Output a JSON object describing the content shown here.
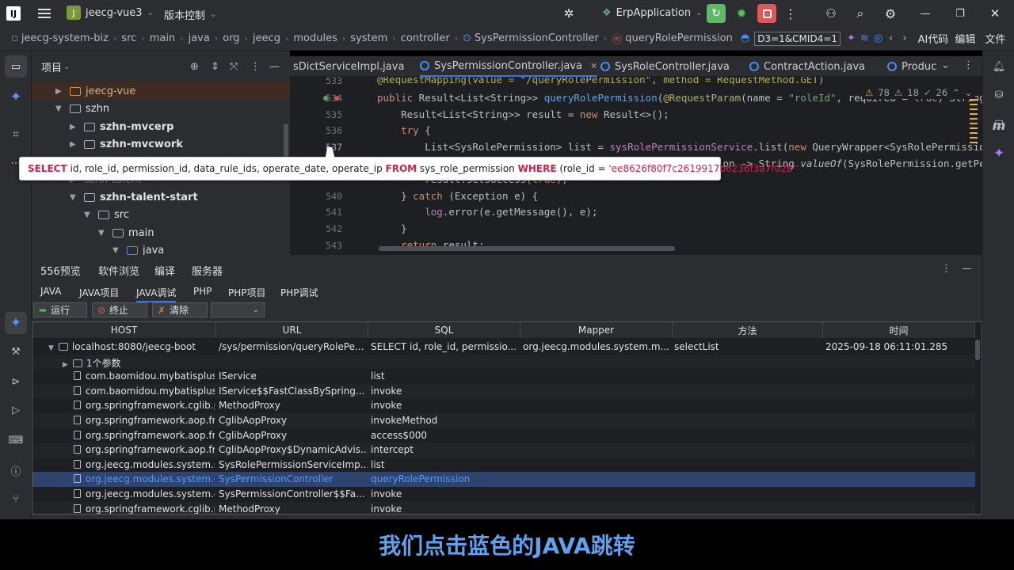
{
  "titlebar": {
    "project_letter": "J",
    "project": "jeecg-vue3",
    "vcs": "版本控制",
    "run_config": "ErpApplication"
  },
  "breadcrumb": [
    "jeecg-system-biz",
    "src",
    "main",
    "java",
    "org",
    "jeecg",
    "modules",
    "system",
    "controller",
    "SysPermissionController",
    "queryRolePermission"
  ],
  "breadcrumb_extra": "D3=1&CMID4=1",
  "ai_label": "AI代码",
  "edit_label": "编辑",
  "file_label": "文件",
  "project_panel": {
    "title": "项目",
    "tree": [
      {
        "label": "jeecg-vue",
        "level": 2,
        "expanded": false
      },
      {
        "label": "szhn",
        "level": 1,
        "expanded": true
      },
      {
        "label": "szhn-mvcerp",
        "level": 2,
        "expanded": false
      },
      {
        "label": "szhn-mvcwork",
        "level": 2,
        "expanded": false
      },
      {
        "label": "szhn-talent",
        "level": 2,
        "expanded": false
      },
      {
        "label": "szhn-talent-start",
        "level": 2,
        "expanded": true
      },
      {
        "label": "src",
        "level": 3,
        "expanded": true
      },
      {
        "label": "main",
        "level": 4,
        "expanded": true
      },
      {
        "label": "java",
        "level": 5,
        "expanded": true
      }
    ]
  },
  "editor": {
    "tabs": [
      "sDictServiceImpl.java",
      "SysPermissionController.java",
      "SysRoleController.java",
      "ContractAction.java",
      "Produc"
    ],
    "active_tab": 1,
    "inspections": {
      "warnings": "78",
      "weak": "18",
      "ok": "26"
    },
    "line_numbers": [
      "533",
      "534",
      "535",
      "536",
      "537",
      "538",
      "539",
      "540",
      "541",
      "542",
      "543"
    ]
  },
  "tooltip": {
    "select": "SELECT",
    "columns": " id, role_id, permission_id, data_rule_ids, operate_date, operate_ip ",
    "from": "FROM",
    "table": " sys_role_permission ",
    "where": "WHERE",
    "cond_open": " (role_id = ",
    "cond_val": "'ee8626f80f7c2619917b6236f3a7f02b'",
    "cond_close": ")"
  },
  "bottom_panel": {
    "tabs": [
      "556预览",
      "软件浏览",
      "编译",
      "服务器"
    ],
    "subtabs": [
      "JAVA",
      "JAVA项目",
      "JAVA调试",
      "PHP",
      "PHP项目",
      "PHP调试"
    ],
    "active_subtab": 2,
    "buttons": {
      "run": "运行",
      "stop": "终止",
      "clear": "清除"
    },
    "columns": [
      "HOST",
      "URL",
      "SQL",
      "Mapper",
      "方法",
      "时间"
    ],
    "rows": [
      {
        "type": "root",
        "host": "localhost:8080/jeecg-boot",
        "url": "/sys/permission/queryRolePe...",
        "sql": "SELECT id, role_id, permissio...",
        "mapper": "org.jeecg.modules.system.m...",
        "method": "selectList",
        "time": "2025-09-18 06:11:01.285"
      },
      {
        "type": "folder",
        "host": "1个参数",
        "url": "",
        "sql": "",
        "mapper": "",
        "method": "",
        "time": ""
      },
      {
        "type": "doc",
        "host": "com.baomidou.mybatisplus.",
        "url": "IService",
        "sql": "list",
        "mapper": "",
        "method": "",
        "time": ""
      },
      {
        "type": "doc",
        "host": "com.baomidou.mybatisplus.",
        "url": "IService$$FastClassBySpring...",
        "sql": "invoke",
        "mapper": "",
        "method": "",
        "time": ""
      },
      {
        "type": "doc",
        "host": "org.springframework.cglib.p",
        "url": "MethodProxy",
        "sql": "invoke",
        "mapper": "",
        "method": "",
        "time": ""
      },
      {
        "type": "doc",
        "host": "org.springframework.aop.fra",
        "url": "CglibAopProxy",
        "sql": "invokeMethod",
        "mapper": "",
        "method": "",
        "time": ""
      },
      {
        "type": "doc",
        "host": "org.springframework.aop.fra",
        "url": "CglibAopProxy",
        "sql": "access$000",
        "mapper": "",
        "method": "",
        "time": ""
      },
      {
        "type": "doc",
        "host": "org.springframework.aop.fra",
        "url": "CglibAopProxy$DynamicAdvis...",
        "sql": "intercept",
        "mapper": "",
        "method": "",
        "time": ""
      },
      {
        "type": "doc",
        "host": "org.jeecg.modules.system.s",
        "url": "SysRolePermissionServiceImp...",
        "sql": "list",
        "mapper": "",
        "method": "",
        "time": ""
      },
      {
        "type": "doc",
        "host": "org.jeecg.modules.system.c",
        "url": "SysPermissionController",
        "sql": "queryRolePermission",
        "mapper": "",
        "method": "",
        "time": "",
        "selected": true
      },
      {
        "type": "doc",
        "host": "org.jeecg.modules.system.c",
        "url": "SysPermissionController$$Fa...",
        "sql": "invoke",
        "mapper": "",
        "method": "",
        "time": ""
      },
      {
        "type": "doc",
        "host": "org.springframework.cglib.p",
        "url": "MethodProxy",
        "sql": "invoke",
        "mapper": "",
        "method": "",
        "time": ""
      }
    ]
  },
  "subtitle": "我们点击蓝色的JAVA跳转",
  "colors": {
    "accent": "#3574f0",
    "selection": "#2e436e",
    "subtitle": "#5ea2f0",
    "run_green": "#5fb865",
    "stop_red": "#e05555"
  }
}
